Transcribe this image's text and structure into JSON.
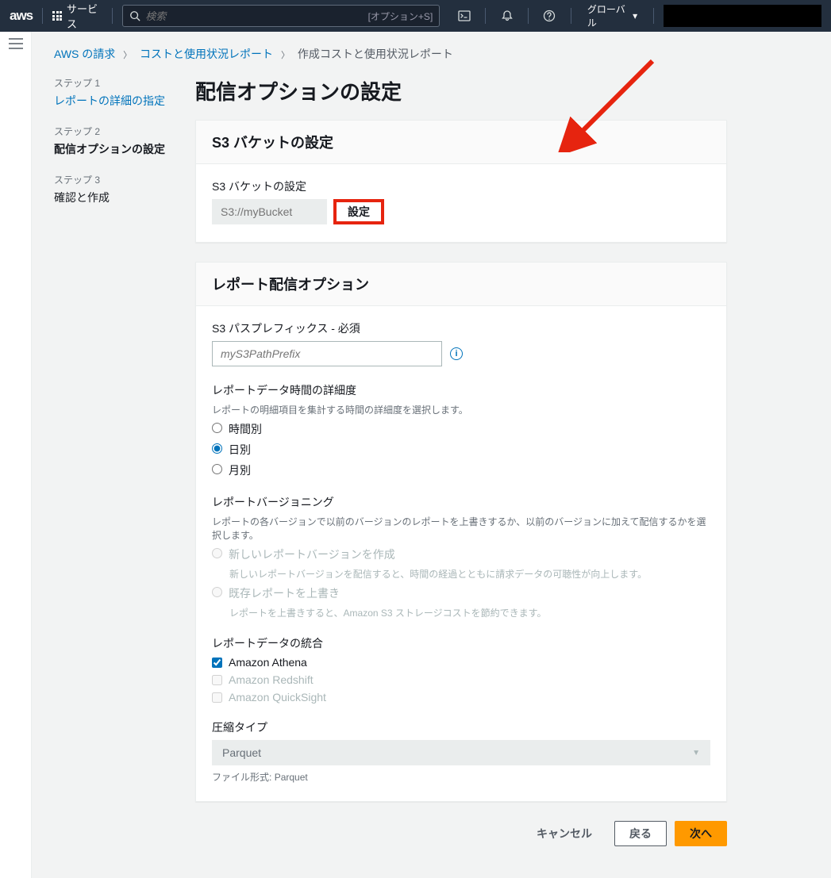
{
  "topbar": {
    "logo": "aws",
    "services": "サービス",
    "search_placeholder": "検索",
    "search_hint": "[オプション+S]",
    "region": "グローバル"
  },
  "breadcrumb": {
    "item1": "AWS の請求",
    "item2": "コストと使用状況レポート",
    "item3": "作成コストと使用状況レポート"
  },
  "steps": {
    "s1_label": "ステップ 1",
    "s1_title": "レポートの詳細の指定",
    "s2_label": "ステップ 2",
    "s2_title": "配信オプションの設定",
    "s3_label": "ステップ 3",
    "s3_title": "確認と作成"
  },
  "page": {
    "title": "配信オプションの設定"
  },
  "panel_s3": {
    "header": "S3 バケットの設定",
    "field_label": "S3 バケットの設定",
    "placeholder": "S3://myBucket",
    "configure_btn": "設定"
  },
  "panel_delivery": {
    "header": "レポート配信オプション",
    "prefix_label": "S3 パスプレフィックス - 必須",
    "prefix_placeholder": "myS3PathPrefix",
    "granularity_label": "レポートデータ時間の詳細度",
    "granularity_desc": "レポートの明細項目を集計する時間の詳細度を選択します。",
    "gran_hourly": "時間別",
    "gran_daily": "日別",
    "gran_monthly": "月別",
    "versioning_label": "レポートバージョニング",
    "versioning_desc": "レポートの各バージョンで以前のバージョンのレポートを上書きするか、以前のバージョンに加えて配信するかを選択します。",
    "ver_create": "新しいレポートバージョンを作成",
    "ver_create_desc": "新しいレポートバージョンを配信すると、時間の経過とともに請求データの可聴性が向上します。",
    "ver_overwrite": "既存レポートを上書き",
    "ver_overwrite_desc": "レポートを上書きすると、Amazon S3 ストレージコストを節約できます。",
    "integration_label": "レポートデータの統合",
    "int_athena": "Amazon Athena",
    "int_redshift": "Amazon Redshift",
    "int_quicksight": "Amazon QuickSight",
    "compression_label": "圧縮タイプ",
    "compression_value": "Parquet",
    "file_format_label": "ファイル形式:",
    "file_format_value": "Parquet"
  },
  "footer": {
    "cancel": "キャンセル",
    "back": "戻る",
    "next": "次へ"
  }
}
